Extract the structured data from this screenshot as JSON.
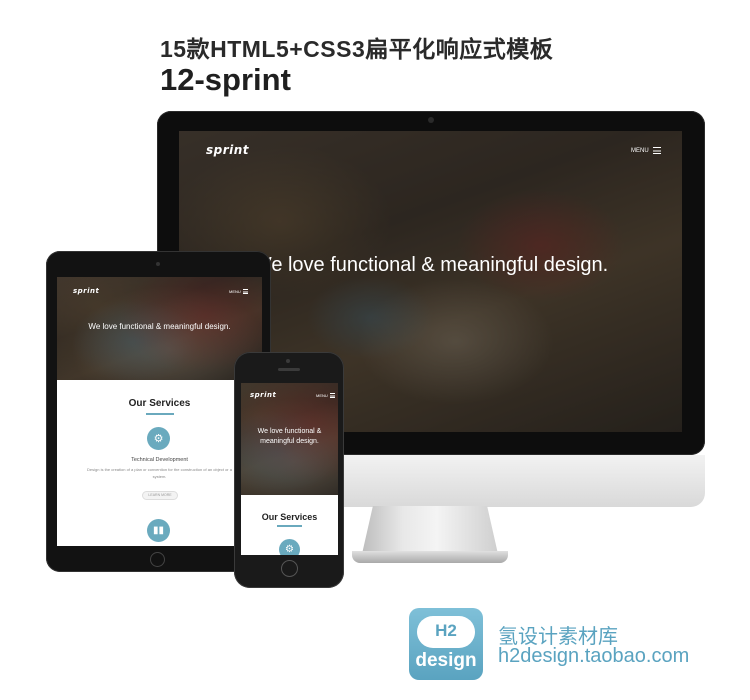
{
  "header": {
    "title": "15款HTML5+CSS3扁平化响应式模板",
    "subtitle": "12-sprint"
  },
  "site": {
    "logo": "sprint",
    "menu_label": "MENU",
    "hero_text": "We love functional & meaningful design.",
    "hero_text_phone_line1": "We love functional &",
    "hero_text_phone_line2": "meaningful design.",
    "services_title": "Our Services",
    "service_name": "Technical Development",
    "service_desc_line1": "Design is the creation of a plan or convention for the construction of an object or a",
    "service_desc_line2": "system.",
    "learn_more": "LEARN MORE"
  },
  "watermark": {
    "badge_top": "H2",
    "badge_label": "design",
    "name": "氢设计素材库",
    "url": "h2design.taobao.com"
  },
  "colors": {
    "accent": "#6aaabe",
    "watermark": "#5aa3c0"
  }
}
